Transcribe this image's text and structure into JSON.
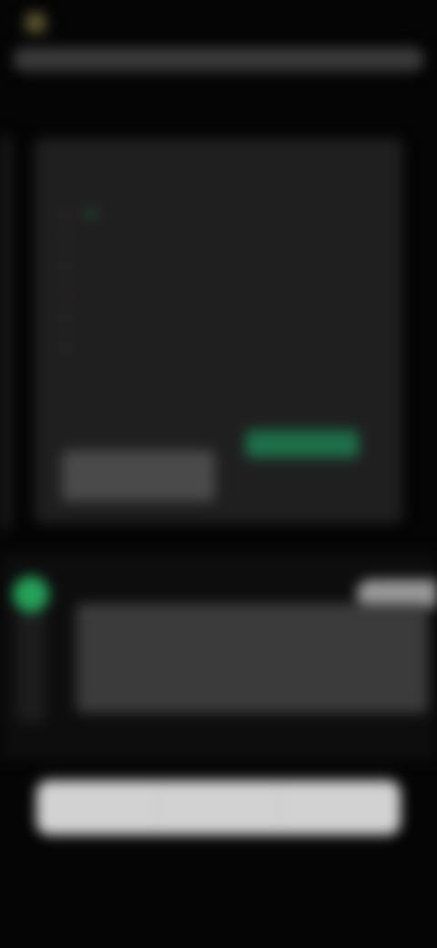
{
  "app": {
    "name": "",
    "logo_color": "#5c5530"
  },
  "search": {
    "placeholder": ""
  },
  "page": {
    "title": ""
  },
  "experience": {
    "title": "",
    "rows": [
      "",
      "",
      "",
      "",
      "",
      ""
    ]
  },
  "payment": {
    "title": "",
    "lines": [
      "",
      ""
    ]
  },
  "buttons": {
    "secondary_label": "",
    "primary_label": "",
    "accept_note": ""
  },
  "chat": {
    "top_pill": "",
    "lines": [
      "",
      "",
      "",
      ""
    ],
    "link": ""
  },
  "action_bar": {
    "items": [
      "",
      "",
      ""
    ]
  },
  "footer": {
    "text": ""
  },
  "colors": {
    "accent_green": "#25a159",
    "primary_button": "#1d6f4a",
    "link_yellow": "#8a7a1a",
    "card_bg": "#1f1f1f"
  }
}
